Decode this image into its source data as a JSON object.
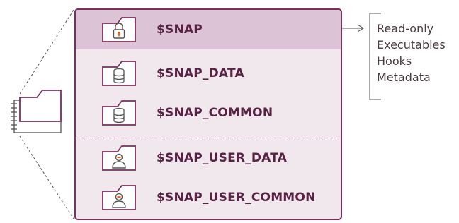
{
  "rows": [
    {
      "label": "$SNAP",
      "icon": "lock-folder-icon",
      "highlighted": true
    },
    {
      "label": "$SNAP_DATA",
      "icon": "database-folder-icon",
      "highlighted": false
    },
    {
      "label": "$SNAP_COMMON",
      "icon": "database-folder-icon",
      "highlighted": false
    },
    {
      "label": "$SNAP_USER_DATA",
      "icon": "user-folder-icon",
      "highlighted": false
    },
    {
      "label": "$SNAP_USER_COMMON",
      "icon": "user-folder-icon",
      "highlighted": false
    }
  ],
  "notes": [
    "Read-only",
    "Executables",
    "Hooks",
    "Metadata"
  ],
  "colors": {
    "accent": "#7b2f5e",
    "panel_bg": "#f1e8ee",
    "highlight_bg": "#dcc4d6",
    "label_text": "#572244",
    "lock_keyhole": "#e0621f"
  }
}
